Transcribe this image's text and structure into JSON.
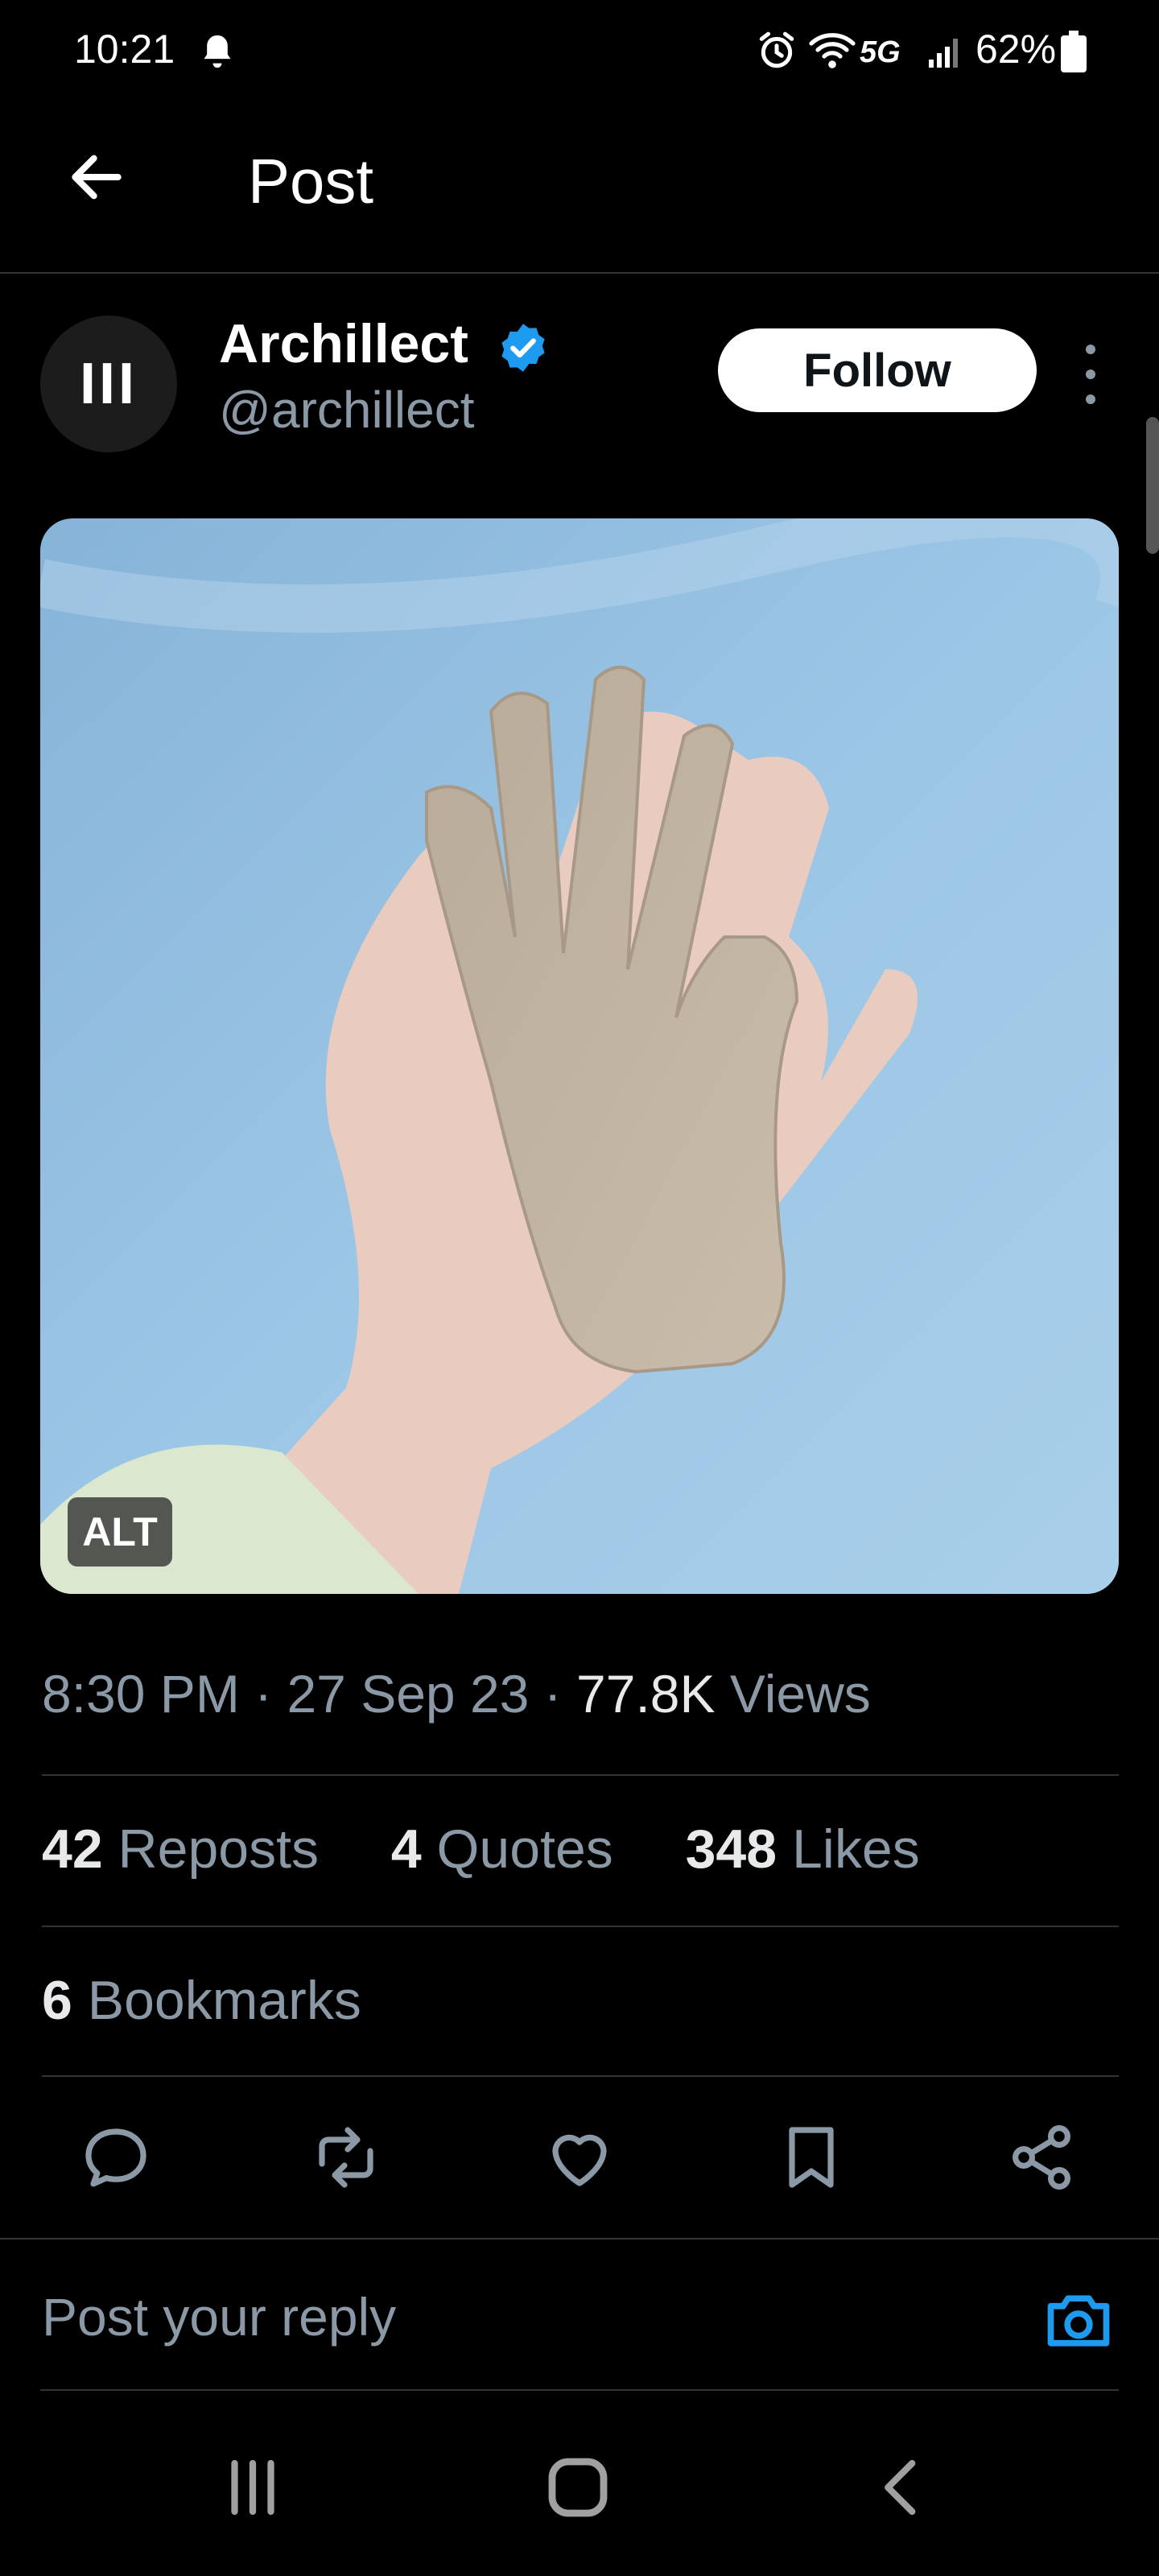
{
  "status_bar": {
    "time": "10:21",
    "network": "5G",
    "battery": "62%"
  },
  "header": {
    "title": "Post"
  },
  "author": {
    "avatar_text": "III",
    "name": "Archillect",
    "handle": "@archillect",
    "verified": true,
    "follow_label": "Follow"
  },
  "media": {
    "alt_badge": "ALT"
  },
  "meta": {
    "time": "8:30 PM",
    "sep1": " · ",
    "date": "27 Sep 23",
    "sep2": " · ",
    "views_count": "77.8K",
    "views_label": " Views"
  },
  "stats": {
    "reposts_count": "42",
    "reposts_label": " Reposts",
    "quotes_count": "4",
    "quotes_label": " Quotes",
    "likes_count": "348",
    "likes_label": " Likes",
    "bookmarks_count": "6",
    "bookmarks_label": " Bookmarks"
  },
  "actions": [
    "reply-icon",
    "repost-icon",
    "like-icon",
    "bookmark-icon",
    "share-icon"
  ],
  "reply": {
    "placeholder": "Post your reply"
  },
  "colors": {
    "background": "#000000",
    "text_primary": "#e7e9ea",
    "text_secondary": "#8b98a5",
    "accent": "#1d9bf0",
    "divider": "#2f3336"
  }
}
